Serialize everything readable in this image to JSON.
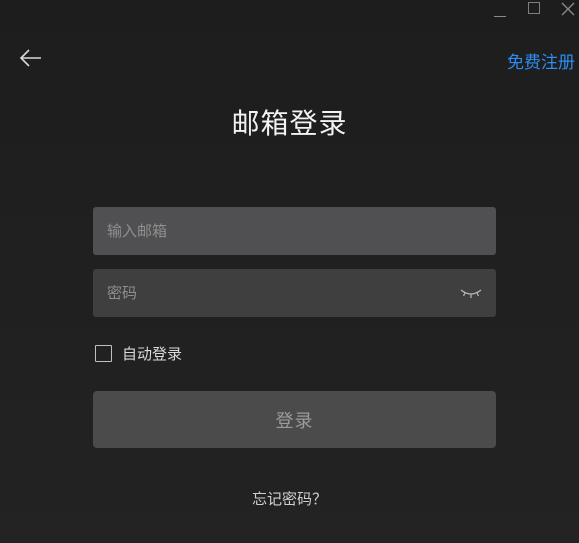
{
  "window": {
    "controls": [
      "minimize",
      "maximize",
      "close"
    ]
  },
  "header": {
    "back_icon": "arrow-left-icon",
    "register_label": "免费注册"
  },
  "main": {
    "title": "邮箱登录",
    "email": {
      "value": "",
      "placeholder": "输入邮箱"
    },
    "password": {
      "value": "",
      "placeholder": "密码",
      "toggle_icon": "eye-closed-icon"
    },
    "auto_login": {
      "label": "自动登录",
      "checked": false
    },
    "login_button_label": "登录",
    "forgot_password_label": "忘记密码？"
  },
  "colors": {
    "background": "#1f1f20",
    "link": "#2d8cf0",
    "button_bg": "#4b4b4c"
  }
}
